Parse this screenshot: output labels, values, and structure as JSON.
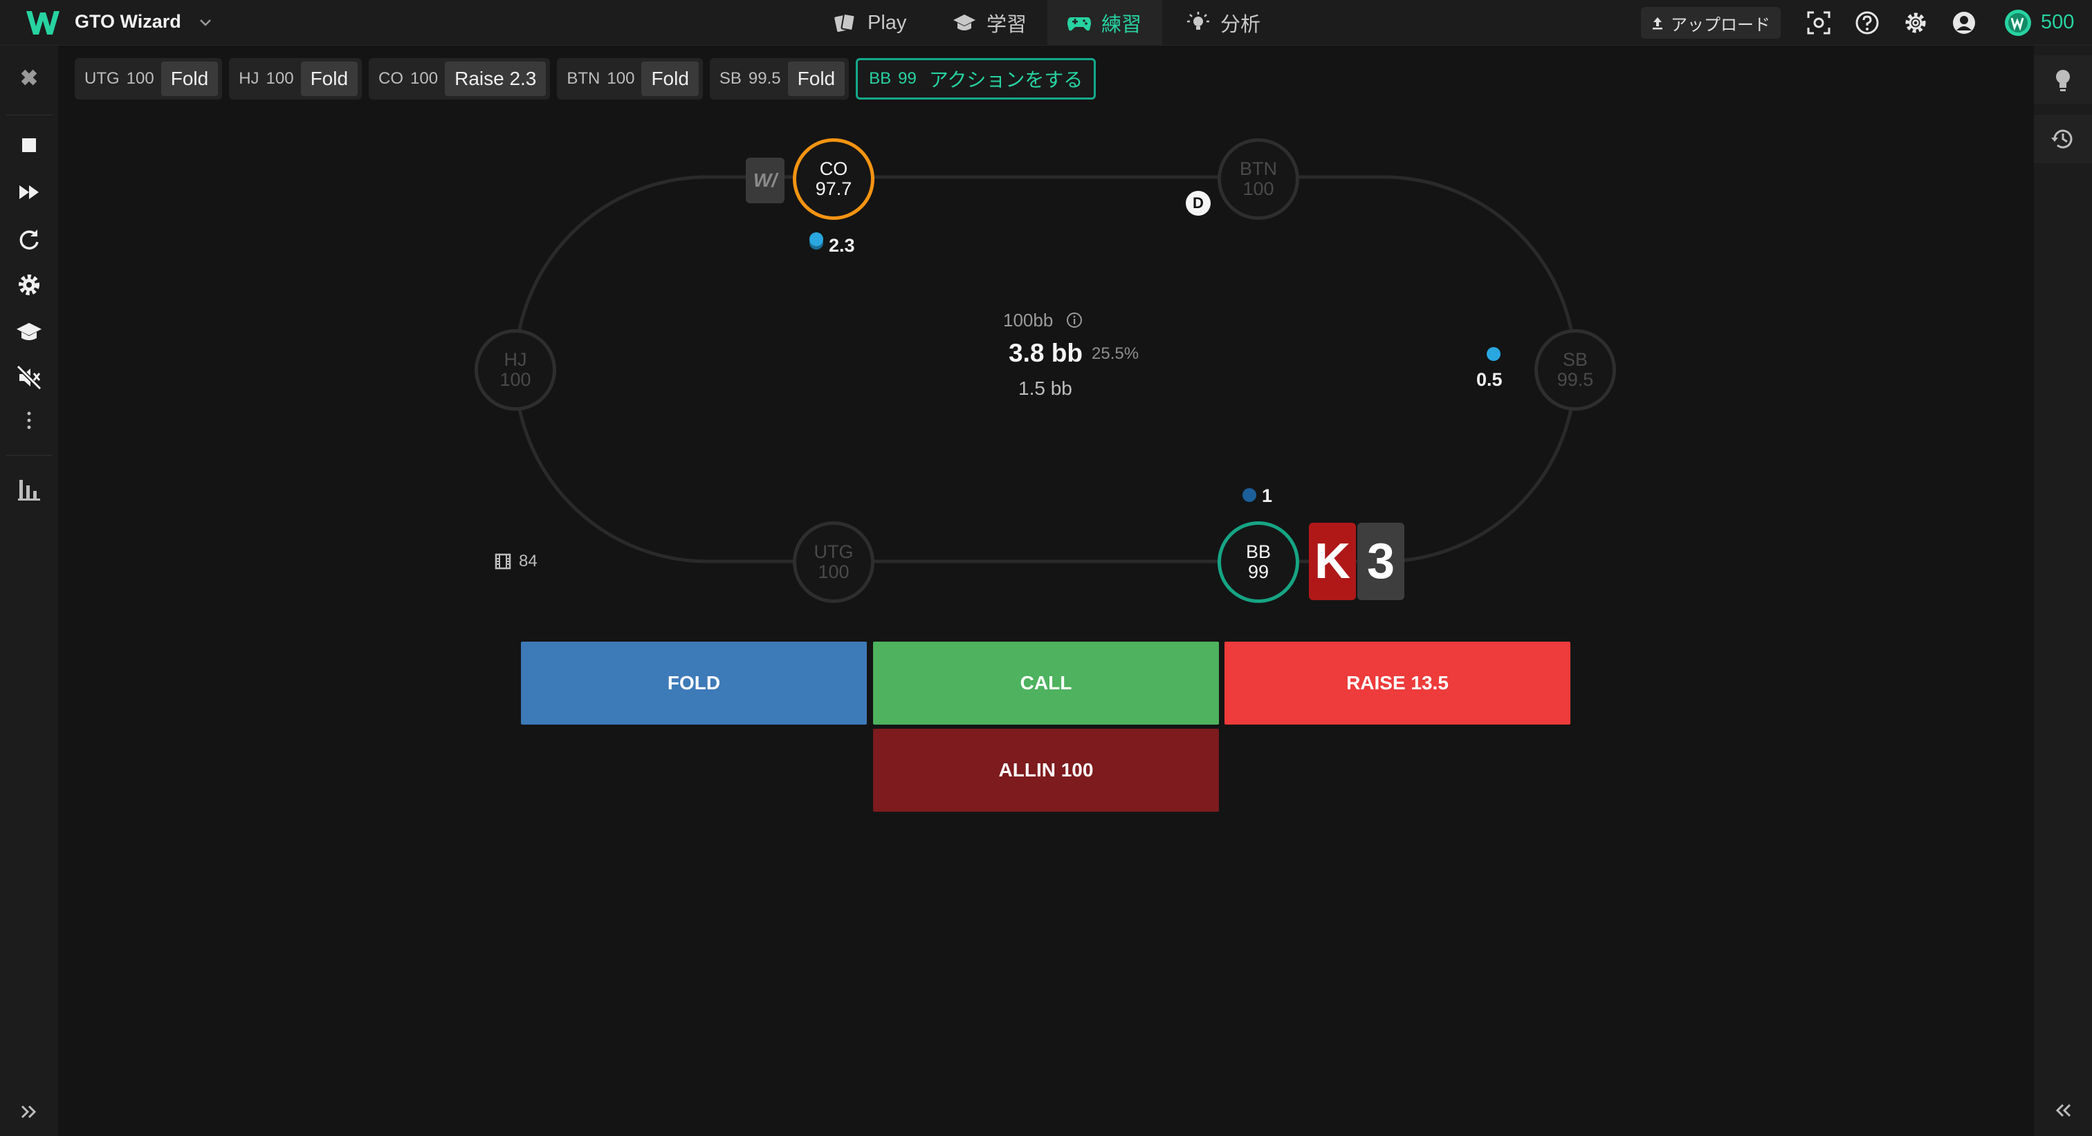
{
  "app": {
    "title": "GTO Wizard"
  },
  "nav": {
    "tabs": [
      {
        "label": "Play",
        "icon": "cards-icon",
        "active": false
      },
      {
        "label": "学習",
        "icon": "graduation-cap-icon",
        "active": false
      },
      {
        "label": "練習",
        "icon": "gamepad-icon",
        "active": true
      },
      {
        "label": "分析",
        "icon": "lightbulb-icon",
        "active": false
      }
    ]
  },
  "header": {
    "upload_label": "アップロード",
    "coins": "500"
  },
  "history": [
    {
      "pos": "UTG",
      "stack": "100",
      "action": "Fold"
    },
    {
      "pos": "HJ",
      "stack": "100",
      "action": "Fold"
    },
    {
      "pos": "CO",
      "stack": "100",
      "action": "Raise 2.3"
    },
    {
      "pos": "BTN",
      "stack": "100",
      "action": "Fold"
    },
    {
      "pos": "SB",
      "stack": "99.5",
      "action": "Fold"
    }
  ],
  "current_action": {
    "pos": "BB",
    "stack": "99",
    "prompt": "アクションをする"
  },
  "seats": {
    "co": {
      "name": "CO",
      "stack": "97.7",
      "bet": "2.3"
    },
    "btn": {
      "name": "BTN",
      "stack": "100"
    },
    "hj": {
      "name": "HJ",
      "stack": "100"
    },
    "sb": {
      "name": "SB",
      "stack": "99.5",
      "bet": "0.5"
    },
    "utg": {
      "name": "UTG",
      "stack": "100"
    },
    "bb": {
      "name": "BB",
      "stack": "99",
      "bet": "1"
    }
  },
  "dealer_label": "D",
  "folded_label": "W/",
  "pot": {
    "effective": "100bb",
    "total": "3.8 bb",
    "pct": "25.5%",
    "main": "1.5 bb"
  },
  "hand_count": "84",
  "hero_cards": [
    {
      "rank": "K",
      "color": "#b01818"
    },
    {
      "rank": "3",
      "color": "#3e3e3e"
    }
  ],
  "actions": {
    "fold": "FOLD",
    "call": "CALL",
    "raise": "RAISE 13.5",
    "allin": "ALLIN 100"
  },
  "colors": {
    "accent": "#27d3a1",
    "fold": "#3d7ab8",
    "call": "#4eb25e",
    "raise": "#ee3b3b",
    "allin": "#7d1b1e",
    "co_ring": "#f39412",
    "bb_ring": "#16a584"
  }
}
